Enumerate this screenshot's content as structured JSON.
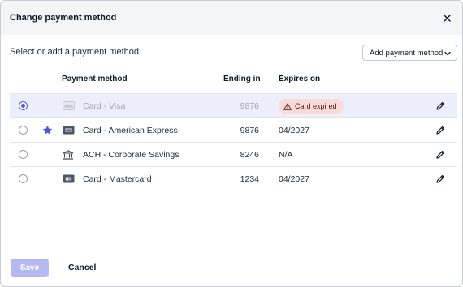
{
  "dialog": {
    "title": "Change payment method",
    "subtitle": "Select or add a payment method",
    "add_button_label": "Add payment method"
  },
  "table": {
    "headers": {
      "payment_method": "Payment method",
      "ending_in": "Ending in",
      "expires_on": "Expires on"
    },
    "rows": [
      {
        "type_icon": "visa-card-icon",
        "icon_text": "VISA",
        "label": "Card - Visa",
        "ending": "9876",
        "expires": "",
        "badge": "Card expired",
        "selected": true,
        "default": false,
        "disabled": true
      },
      {
        "type_icon": "amex-card-icon",
        "icon_text": "",
        "label": "Card - American Express",
        "ending": "9876",
        "expires": "04/2027",
        "badge": "",
        "selected": false,
        "default": true,
        "disabled": false
      },
      {
        "type_icon": "bank-icon",
        "icon_text": "",
        "label": "ACH - Corporate Savings",
        "ending": "8246",
        "expires": "N/A",
        "badge": "",
        "selected": false,
        "default": false,
        "disabled": false
      },
      {
        "type_icon": "mastercard-icon",
        "icon_text": "",
        "label": "Card - Mastercard",
        "ending": "1234",
        "expires": "04/2027",
        "badge": "",
        "selected": false,
        "default": false,
        "disabled": false
      }
    ]
  },
  "footer": {
    "save_label": "Save",
    "cancel_label": "Cancel"
  },
  "colors": {
    "accent": "#4b59e0",
    "selected_row": "#eceefb",
    "badge_bg": "#fad9d6",
    "save_disabled": "#b4b9f2"
  }
}
